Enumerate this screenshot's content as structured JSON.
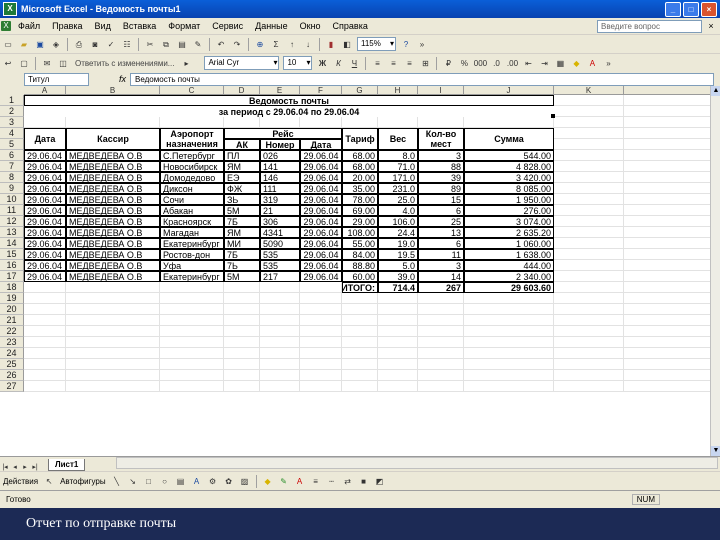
{
  "window": {
    "title": "Microsoft Excel - Ведомость почты1"
  },
  "menu": {
    "items": [
      "Файл",
      "Правка",
      "Вид",
      "Вставка",
      "Формат",
      "Сервис",
      "Данные",
      "Окно",
      "Справка"
    ],
    "help_placeholder": "Введите вопрос"
  },
  "toolbar": {
    "zoom": "115%",
    "font": "Arial Cyr",
    "font_size": "10",
    "unlock_label": "Ответить с изменениями..."
  },
  "formula": {
    "name_box": "Титул",
    "value": "Ведомость почты"
  },
  "columns": [
    "A",
    "B",
    "C",
    "D",
    "E",
    "F",
    "G",
    "H",
    "I",
    "J",
    "K"
  ],
  "rows": [
    "1",
    "2",
    "3",
    "4",
    "5",
    "6",
    "7",
    "8",
    "9",
    "10",
    "11",
    "12",
    "13",
    "14",
    "15",
    "16",
    "17",
    "18",
    "19",
    "20",
    "21",
    "22",
    "23",
    "24",
    "25",
    "26",
    "27"
  ],
  "report": {
    "title": "Ведомость почты",
    "period": "за период с 29.06.04 по 29.06.04",
    "headers": {
      "date": "Дата",
      "cashier": "Кассир",
      "airport": "Аэропорт назначения",
      "flight": "Рейс",
      "ak": "АК",
      "number": "Номер",
      "flight_date": "Дата",
      "tariff": "Тариф",
      "weight": "Вес",
      "qty": "Кол-во мест",
      "sum": "Сумма"
    },
    "rows": [
      [
        "29.06.04",
        "МЕДВЕДЕВА О.В",
        "С.Петербург",
        "ПЛ",
        "026",
        "29.06.04",
        "68.00",
        "8.0",
        "3",
        "544.00"
      ],
      [
        "29.06.04",
        "МЕДВЕДЕВА О.В",
        "Новосибирск",
        "ЯМ",
        "141",
        "29.06.04",
        "68.00",
        "71.0",
        "88",
        "4 828.00"
      ],
      [
        "29.06.04",
        "МЕДВЕДЕВА О.В",
        "Домодедово",
        "ЕЭ",
        "146",
        "29.06.04",
        "20.00",
        "171.0",
        "39",
        "3 420.00"
      ],
      [
        "29.06.04",
        "МЕДВЕДЕВА О.В",
        "Диксон",
        "ФЖ",
        "111",
        "29.06.04",
        "35.00",
        "231.0",
        "89",
        "8 085.00"
      ],
      [
        "29.06.04",
        "МЕДВЕДЕВА О.В",
        "Сочи",
        "ЗЬ",
        "319",
        "29.06.04",
        "78.00",
        "25.0",
        "15",
        "1 950.00"
      ],
      [
        "29.06.04",
        "МЕДВЕДЕВА О.В",
        "Абакан",
        "5М",
        "21",
        "29.06.04",
        "69.00",
        "4.0",
        "6",
        "276.00"
      ],
      [
        "29.06.04",
        "МЕДВЕДЕВА О.В",
        "Красноярск",
        "7Б",
        "306",
        "29.06.04",
        "29.00",
        "106.0",
        "25",
        "3 074.00"
      ],
      [
        "29.06.04",
        "МЕДВЕДЕВА О.В",
        "Магадан",
        "ЯМ",
        "4341",
        "29.06.04",
        "108.00",
        "24.4",
        "13",
        "2 635.20"
      ],
      [
        "29.06.04",
        "МЕДВЕДЕВА О.В",
        "Екатеринбург",
        "МИ",
        "5090",
        "29.06.04",
        "55.00",
        "19.0",
        "6",
        "1 060.00"
      ],
      [
        "29.06.04",
        "МЕДВЕДЕВА О.В",
        "Ростов-дон",
        "7Б",
        "535",
        "29.06.04",
        "84.00",
        "19.5",
        "11",
        "1 638.00"
      ],
      [
        "29.06.04",
        "МЕДВЕДЕВА О.В",
        "Уфа",
        "7Ь",
        "535",
        "29.06.04",
        "88.80",
        "5.0",
        "3",
        "444.00"
      ],
      [
        "29.06.04",
        "МЕДВЕДЕВА О.В",
        "Екатеринбург",
        "5М",
        "217",
        "29.06.04",
        "60.00",
        "39.0",
        "14",
        "2 340.00"
      ]
    ],
    "total_label": "ИТОГО:",
    "total_weight": "714.4",
    "total_qty": "267",
    "total_sum": "29 603.60"
  },
  "sheet_tab": "Лист1",
  "drawbar": {
    "actions": "Действия",
    "autoshapes": "Автофигуры"
  },
  "status": {
    "ready": "Готово",
    "num": "NUM"
  },
  "caption": "Отчет по отправке почты"
}
